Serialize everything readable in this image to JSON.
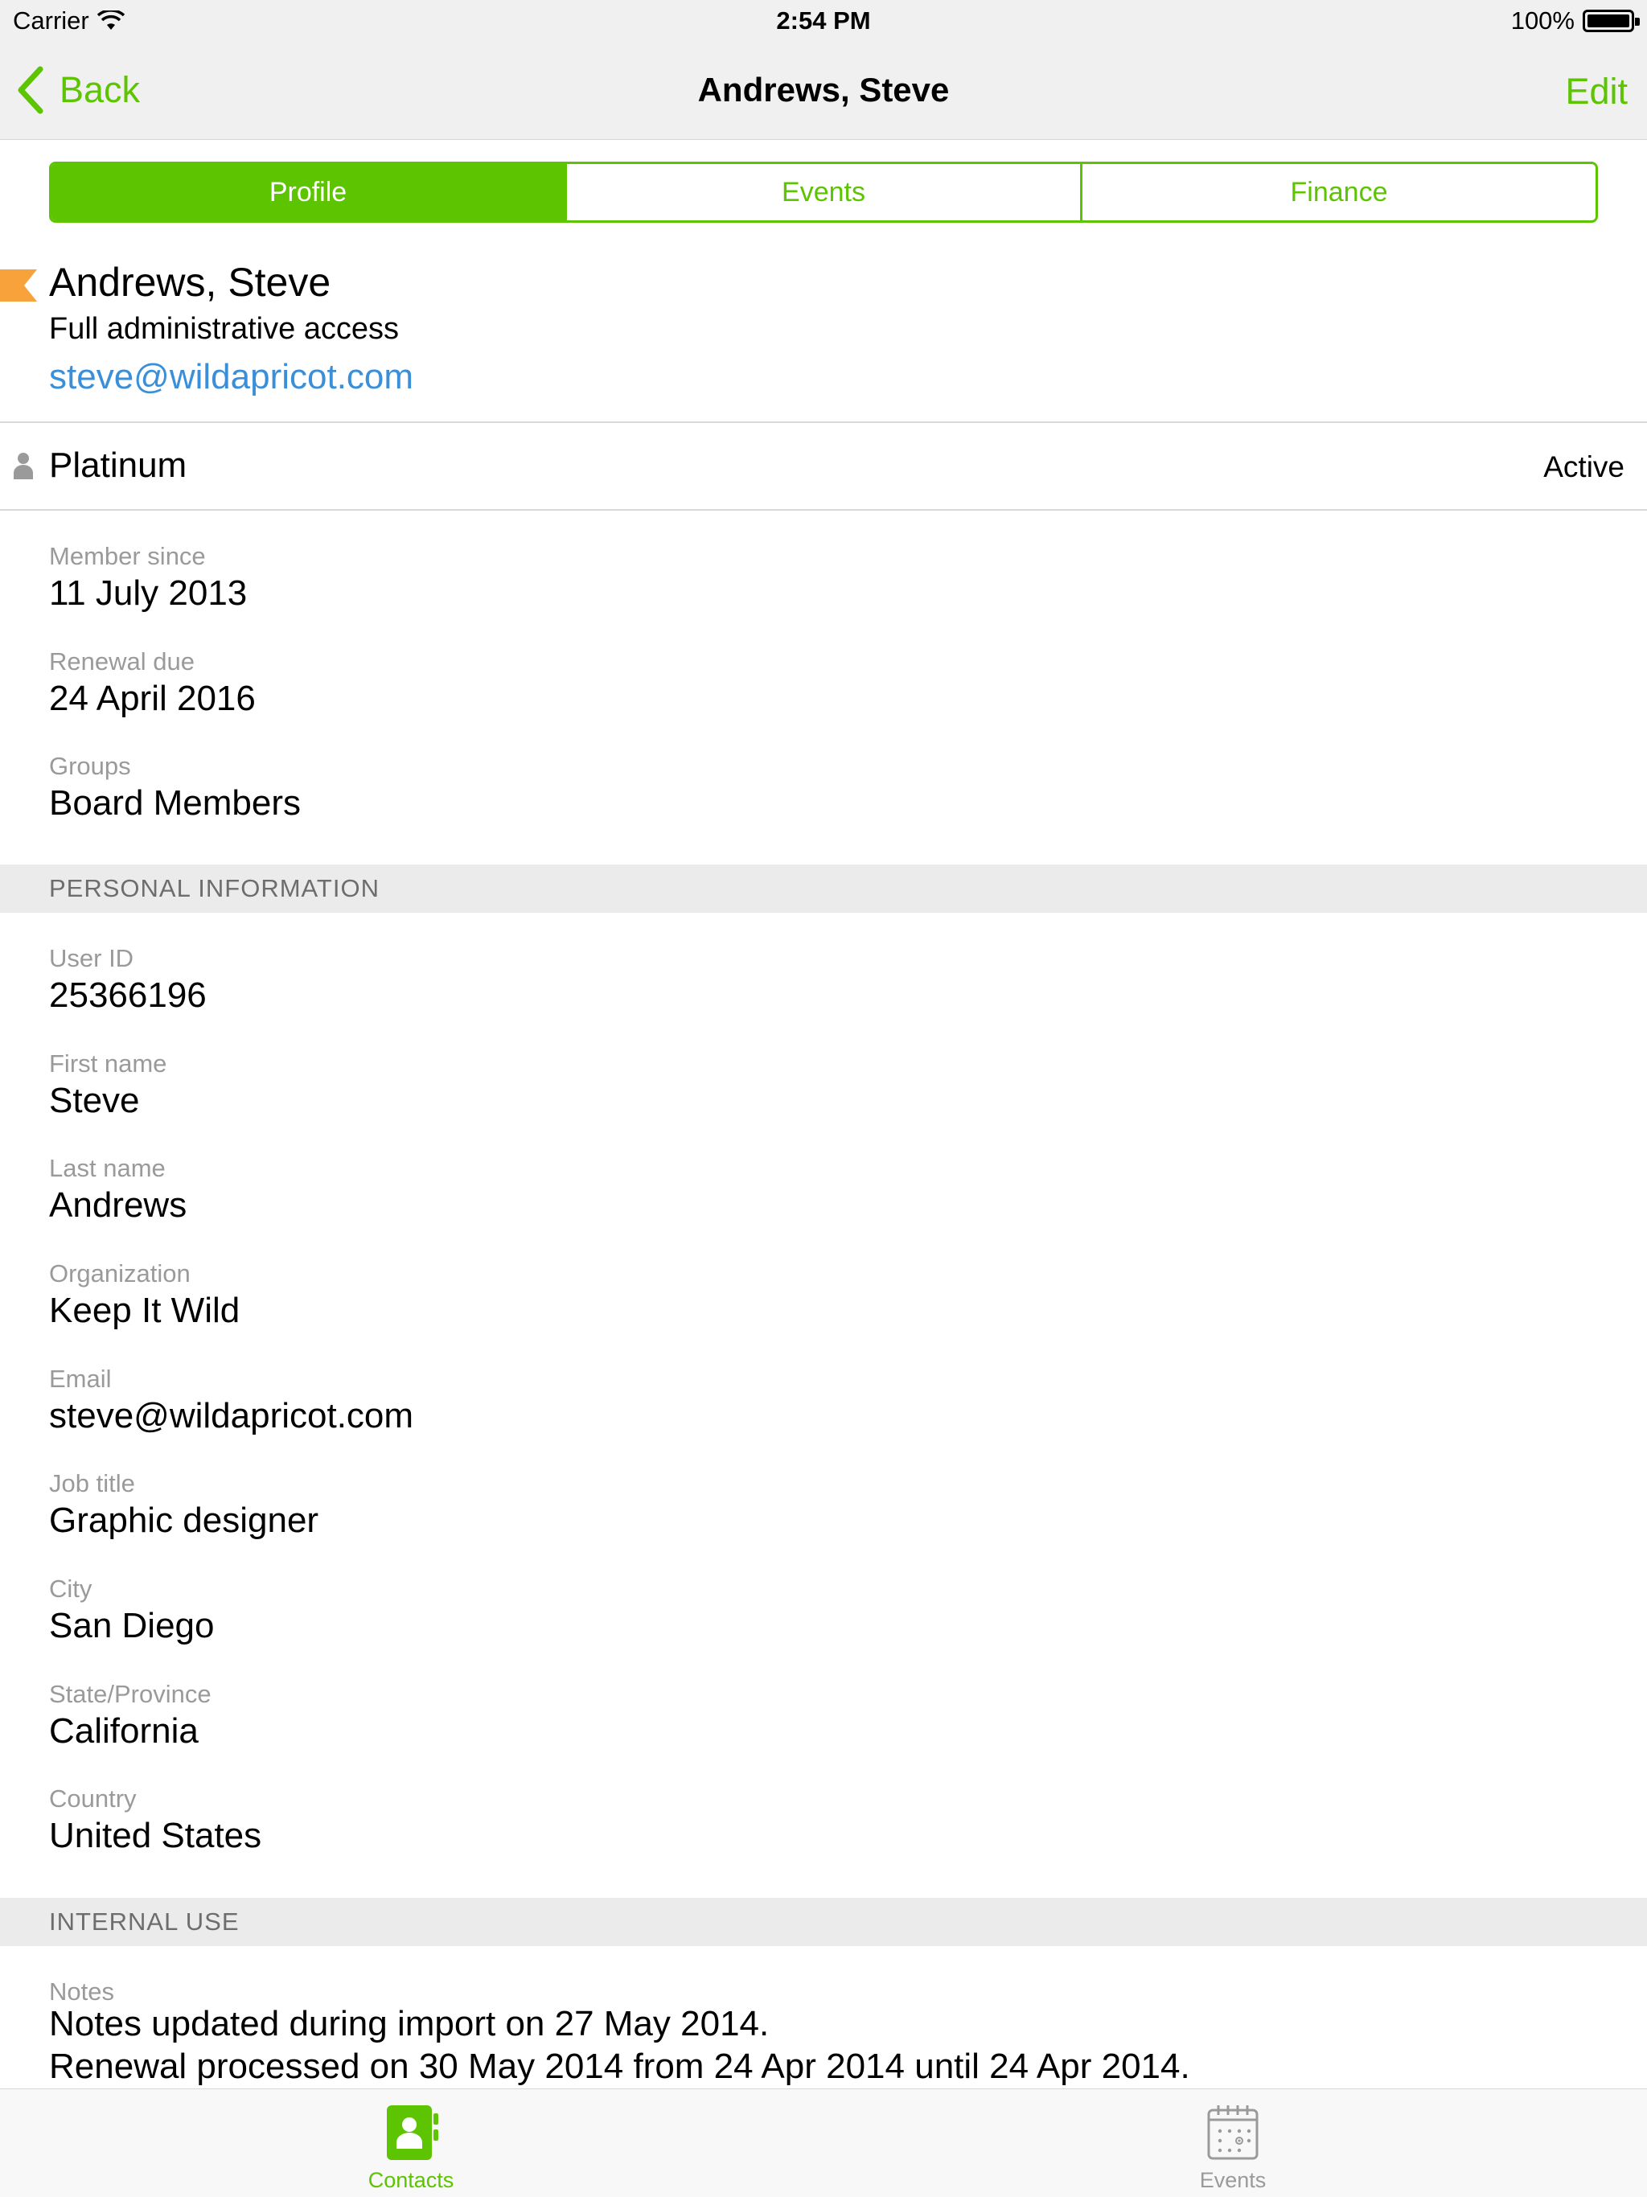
{
  "status_bar": {
    "carrier": "Carrier",
    "time": "2:54 PM",
    "battery": "100%"
  },
  "nav": {
    "back_label": "Back",
    "title": "Andrews, Steve",
    "edit_label": "Edit"
  },
  "segments": {
    "profile": "Profile",
    "events": "Events",
    "finance": "Finance",
    "selected": "Profile"
  },
  "header": {
    "name": "Andrews, Steve",
    "access": "Full administrative access",
    "email": "steve@wildapricot.com"
  },
  "membership": {
    "level": "Platinum",
    "status": "Active",
    "member_since_label": "Member since",
    "member_since": "11 July 2013",
    "renewal_label": "Renewal due",
    "renewal": "24 April 2016",
    "groups_label": "Groups",
    "groups": "Board Members"
  },
  "personal": {
    "section_title": "PERSONAL INFORMATION",
    "fields": [
      {
        "label": "User ID",
        "value": "25366196"
      },
      {
        "label": "First name",
        "value": "Steve"
      },
      {
        "label": "Last name",
        "value": "Andrews"
      },
      {
        "label": "Organization",
        "value": "Keep It Wild"
      },
      {
        "label": "Email",
        "value": "steve@wildapricot.com"
      },
      {
        "label": "Job title",
        "value": "Graphic designer"
      },
      {
        "label": "City",
        "value": "San Diego"
      },
      {
        "label": "State/Province",
        "value": "California"
      },
      {
        "label": "Country",
        "value": "United States"
      }
    ]
  },
  "internal": {
    "section_title": "INTERNAL USE",
    "notes_label": "Notes",
    "notes_line1": "Notes updated during import on 27 May 2014.",
    "notes_line2": "Renewal processed on 30 May 2014 from 24 Apr 2014 until 24 Apr 2014."
  },
  "tabbar": {
    "contacts": "Contacts",
    "events": "Events",
    "selected": "Contacts"
  },
  "colors": {
    "accent": "#5cc400",
    "link": "#3b8fd8",
    "flag": "#f7a23b"
  }
}
